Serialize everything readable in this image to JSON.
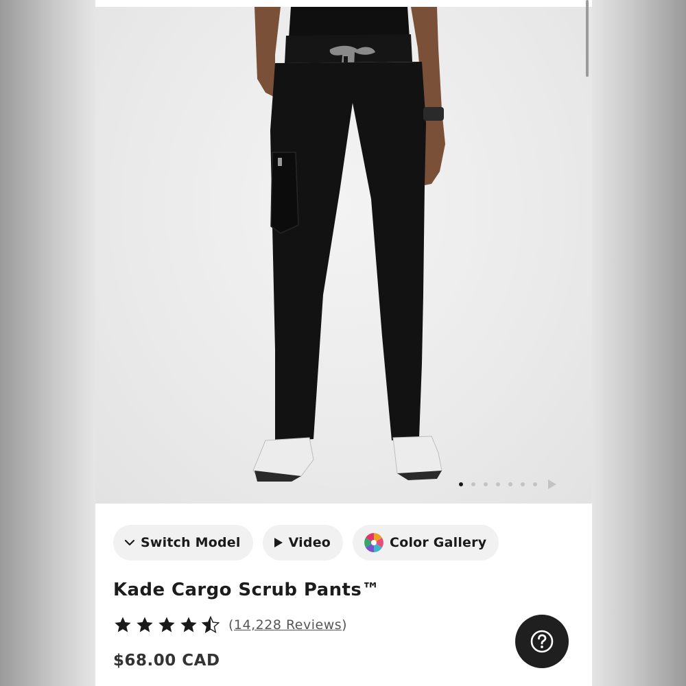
{
  "gallery": {
    "image_count": 7,
    "active_index": 0,
    "next_icon": "play-right-icon"
  },
  "actions": {
    "switch_model": {
      "icon": "chevron-down-icon",
      "label": "Switch Model"
    },
    "video": {
      "icon": "play-icon",
      "label": "Video"
    },
    "color_gallery": {
      "icon": "color-wheel-icon",
      "label": "Color Gallery"
    }
  },
  "product": {
    "name": "Kade Cargo Scrub Pants™",
    "rating": 4.5,
    "rating_max": 5,
    "reviews_open": "(",
    "reviews_text": "14,228 Reviews",
    "reviews_close": ")",
    "price": "$68.00 CAD"
  },
  "help": {
    "icon": "question-circle-icon"
  },
  "colors": {
    "text": "#1c1c1c",
    "chip_bg": "#f1f1f1",
    "help_bg": "#1f1f1f",
    "star": "#1a1a1a"
  }
}
